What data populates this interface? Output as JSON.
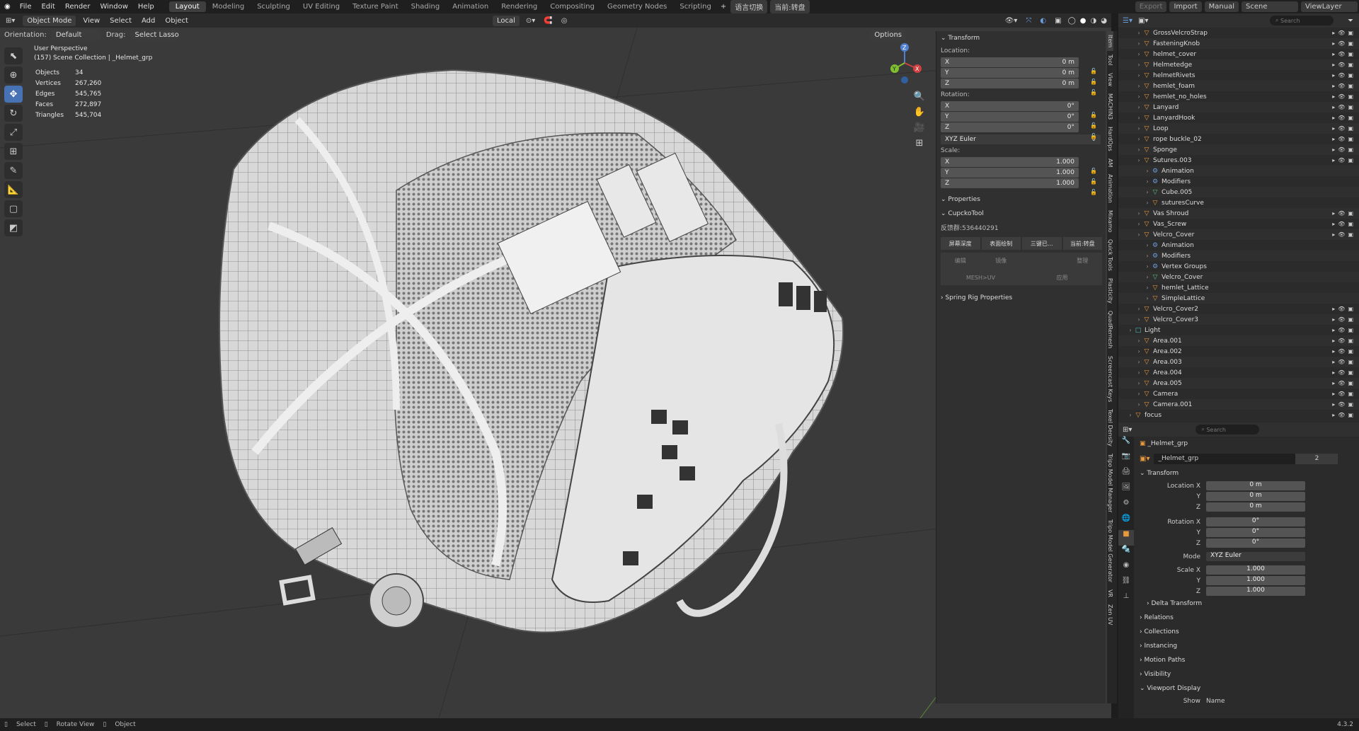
{
  "topbar": {
    "menus": [
      "File",
      "Edit",
      "Render",
      "Window",
      "Help"
    ],
    "workspaces": [
      "Layout",
      "Modeling",
      "Sculpting",
      "UV Editing",
      "Texture Paint",
      "Shading",
      "Animation",
      "Rendering",
      "Compositing",
      "Geometry Nodes",
      "Scripting"
    ],
    "extra": [
      "语言切换",
      "当前:转盘"
    ],
    "right": [
      "Export",
      "Import",
      "Manual",
      "Scene",
      "ViewLayer"
    ]
  },
  "viewport": {
    "mode": "Object Mode",
    "menus": [
      "View",
      "Select",
      "Add",
      "Object"
    ],
    "transform_space": "Local",
    "orientation_label": "Orientation:",
    "orientation_value": "Default",
    "drag_label": "Drag:",
    "drag_value": "Select Lasso",
    "options": "Options",
    "perspective": "User Perspective",
    "collection": "(157) Scene Collection | _Helmet_grp",
    "stats": [
      {
        "k": "Objects",
        "v": "34"
      },
      {
        "k": "Vertices",
        "v": "267,260"
      },
      {
        "k": "Edges",
        "v": "545,765"
      },
      {
        "k": "Faces",
        "v": "272,897"
      },
      {
        "k": "Triangles",
        "v": "545,704"
      }
    ],
    "gizmo": {
      "x": "X",
      "y": "Y",
      "z": "Z"
    }
  },
  "npanel": {
    "transform": "Transform",
    "location": "Location:",
    "loc": [
      {
        "a": "X",
        "v": "0 m"
      },
      {
        "a": "Y",
        "v": "0 m"
      },
      {
        "a": "Z",
        "v": "0 m"
      }
    ],
    "rotation": "Rotation:",
    "rot": [
      {
        "a": "X",
        "v": "0°"
      },
      {
        "a": "Y",
        "v": "0°"
      },
      {
        "a": "Z",
        "v": "0°"
      }
    ],
    "euler": "XYZ Euler",
    "scale": "Scale:",
    "scl": [
      {
        "a": "X",
        "v": "1.000"
      },
      {
        "a": "Y",
        "v": "1.000"
      },
      {
        "a": "Z",
        "v": "1.000"
      }
    ],
    "properties": "Properties",
    "cupcko": "CupckoTool",
    "feedback": "反馈群:536440291",
    "buttons": [
      "屏幕深度",
      "表面绘制",
      "三键已...",
      "当前:转盘"
    ],
    "buttons2": [
      "编辑",
      "镜像",
      "整理"
    ],
    "buttons3": [
      "MESH>UV",
      "应用"
    ],
    "spring": "Spring Rig Properties",
    "tabs": [
      "Item",
      "Tool",
      "View",
      "MACHIN3",
      "HardOps",
      "AM",
      "Animation",
      "Mixamo",
      "Quick Tools",
      "Plasticity",
      "QuadRemesh",
      "Screencast Keys",
      "Texel Density",
      "Tripo Model Manager",
      "Tripo Model Generator",
      "VR",
      "Zen UV"
    ]
  },
  "outliner": {
    "search": "Search",
    "items": [
      {
        "n": "GrossVelcroStrap",
        "lvl": 2,
        "c": "orange"
      },
      {
        "n": "FasteningKnob",
        "lvl": 2,
        "c": "orange"
      },
      {
        "n": "helmet_cover",
        "lvl": 2,
        "c": "orange"
      },
      {
        "n": "Helmetedge",
        "lvl": 2,
        "c": "orange"
      },
      {
        "n": "helmetRivets",
        "lvl": 2,
        "c": "orange"
      },
      {
        "n": "hemlet_foam",
        "lvl": 2,
        "c": "orange"
      },
      {
        "n": "hemlet_no_holes",
        "lvl": 2,
        "c": "orange"
      },
      {
        "n": "Lanyard",
        "lvl": 2,
        "c": "orange"
      },
      {
        "n": "LanyardHook",
        "lvl": 2,
        "c": "orange"
      },
      {
        "n": "Loop",
        "lvl": 2,
        "c": "orange"
      },
      {
        "n": "rope buckle_02",
        "lvl": 2,
        "c": "orange"
      },
      {
        "n": "Sponge",
        "lvl": 2,
        "c": "orange"
      },
      {
        "n": "Sutures.003",
        "lvl": 2,
        "c": "orange"
      },
      {
        "n": "Animation",
        "lvl": 3,
        "c": "blue2"
      },
      {
        "n": "Modifiers",
        "lvl": 3,
        "c": "blue2"
      },
      {
        "n": "Cube.005",
        "lvl": 3,
        "c": "green"
      },
      {
        "n": "suturesCurve",
        "lvl": 3,
        "c": "orange"
      },
      {
        "n": "Vas Shroud",
        "lvl": 2,
        "c": "orange"
      },
      {
        "n": "Vas_Screw",
        "lvl": 2,
        "c": "orange"
      },
      {
        "n": "Velcro_Cover",
        "lvl": 2,
        "c": "orange"
      },
      {
        "n": "Animation",
        "lvl": 3,
        "c": "blue2"
      },
      {
        "n": "Modifiers",
        "lvl": 3,
        "c": "blue2"
      },
      {
        "n": "Vertex Groups",
        "lvl": 3,
        "c": "blue2"
      },
      {
        "n": "Velcro_Cover",
        "lvl": 3,
        "c": "green"
      },
      {
        "n": "hemlet_Lattice",
        "lvl": 3,
        "c": "orange"
      },
      {
        "n": "SimpleLattice",
        "lvl": 3,
        "c": "orange"
      },
      {
        "n": "Velcro_Cover2",
        "lvl": 2,
        "c": "orange"
      },
      {
        "n": "Velcro_Cover3",
        "lvl": 2,
        "c": "orange"
      },
      {
        "n": "Light",
        "lvl": 1,
        "c": "teal"
      },
      {
        "n": "Area.001",
        "lvl": 2,
        "c": "orange"
      },
      {
        "n": "Area.002",
        "lvl": 2,
        "c": "orange"
      },
      {
        "n": "Area.003",
        "lvl": 2,
        "c": "orange"
      },
      {
        "n": "Area.004",
        "lvl": 2,
        "c": "orange"
      },
      {
        "n": "Area.005",
        "lvl": 2,
        "c": "orange"
      },
      {
        "n": "Camera",
        "lvl": 2,
        "c": "orange"
      },
      {
        "n": "Camera.001",
        "lvl": 2,
        "c": "orange"
      },
      {
        "n": "focus",
        "lvl": 1,
        "c": "orange"
      }
    ]
  },
  "properties": {
    "search": "Search",
    "object": "_Helmet_grp",
    "object_field": "_Helmet_grp",
    "users": "2",
    "transform": "Transform",
    "rows": [
      {
        "k": "Location X",
        "v": "0 m"
      },
      {
        "k": "Y",
        "v": "0 m"
      },
      {
        "k": "Z",
        "v": "0 m"
      },
      {
        "k": "Rotation X",
        "v": "0°"
      },
      {
        "k": "Y",
        "v": "0°"
      },
      {
        "k": "Z",
        "v": "0°"
      },
      {
        "k": "Mode",
        "v": "XYZ Euler"
      },
      {
        "k": "Scale X",
        "v": "1.000"
      },
      {
        "k": "Y",
        "v": "1.000"
      },
      {
        "k": "Z",
        "v": "1.000"
      }
    ],
    "sections": [
      "Delta Transform",
      "Relations",
      "Collections",
      "Instancing",
      "Motion Paths",
      "Visibility",
      "Viewport Display"
    ],
    "show": "Show",
    "name": "Name"
  },
  "status": {
    "select": "Select",
    "rotate": "Rotate View",
    "object": "Object",
    "version": "4.3.2"
  }
}
